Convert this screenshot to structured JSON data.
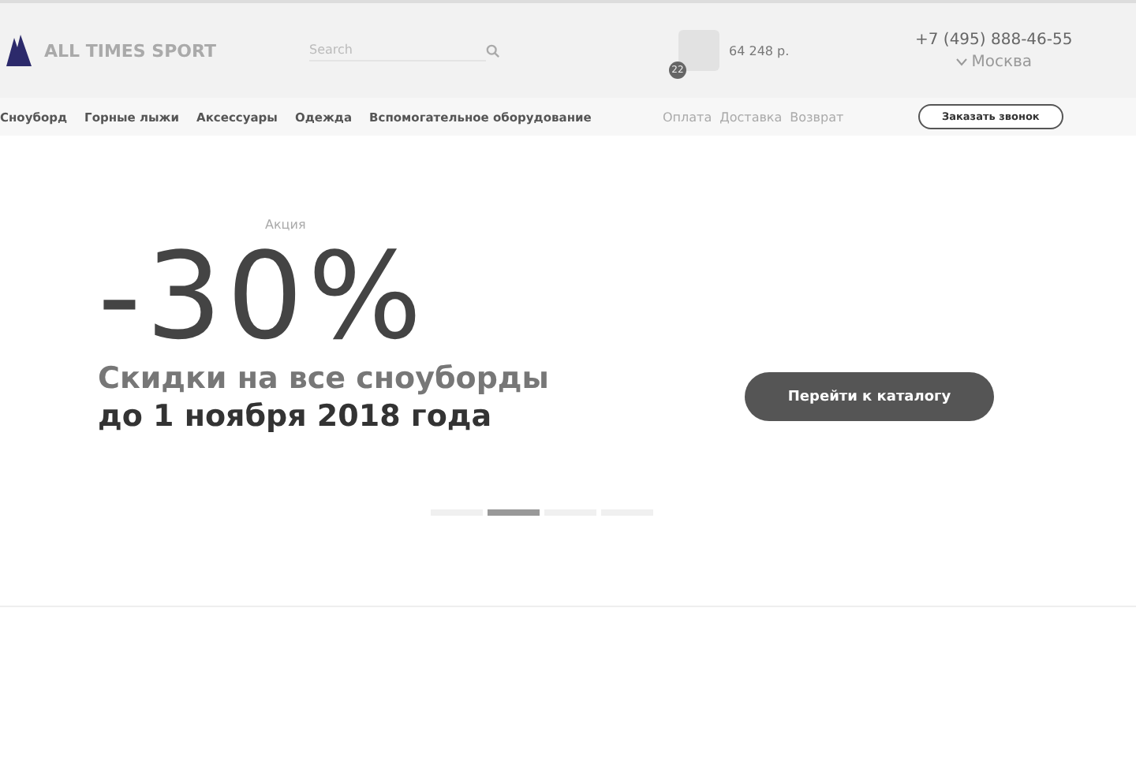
{
  "header": {
    "logo_text": "ALL TIMES SPORT",
    "search": {
      "placeholder": "Search"
    },
    "cart": {
      "count": "22",
      "total": "64 248 р."
    },
    "phone": "+7 (495) 888-46-55",
    "city": "Москва"
  },
  "nav": {
    "categories": [
      "Сноуборд",
      "Горные лыжи",
      "Аксессуары",
      "Одежда",
      "Вспомогательное оборудование"
    ],
    "info_links": [
      "Оплата",
      "Доставка",
      "Возврат"
    ],
    "callback_button": "Заказать звонок"
  },
  "hero": {
    "label": "Акция",
    "discount": "-30%",
    "subtitle": "Скидки на все сноуборды",
    "deadline": "до 1 ноября 2018 года",
    "button": "Перейти к каталогу",
    "slides": [
      {
        "selected": false
      },
      {
        "selected": true
      },
      {
        "selected": false
      },
      {
        "selected": false
      }
    ]
  }
}
